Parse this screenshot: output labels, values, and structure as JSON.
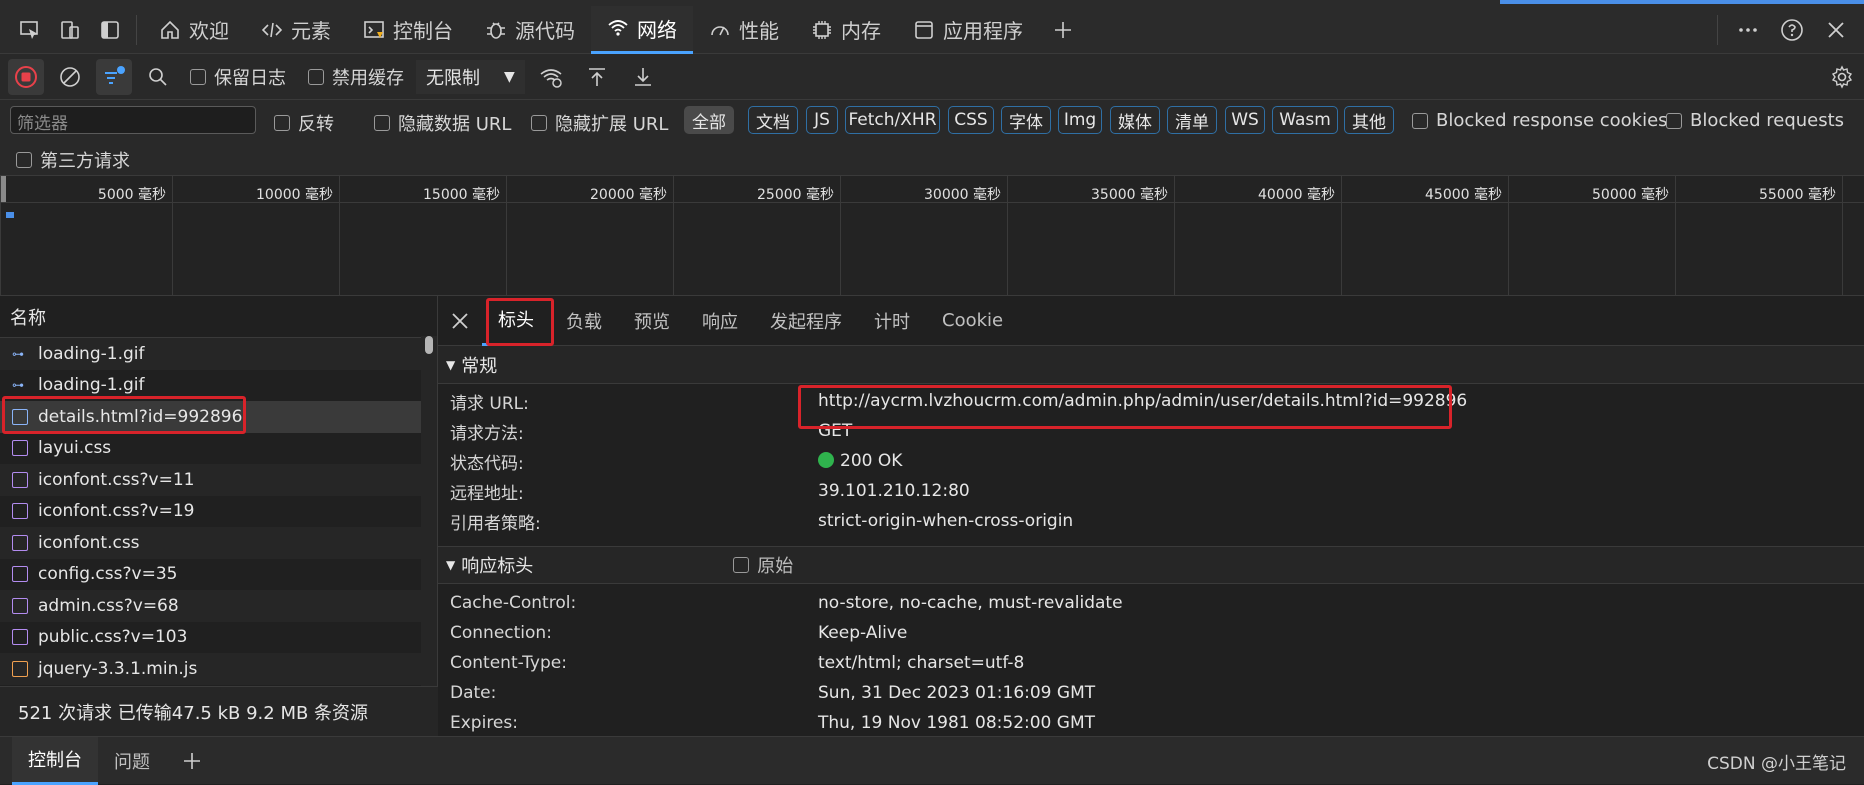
{
  "tabs": [
    {
      "label": "欢迎",
      "icon": "home-icon"
    },
    {
      "label": "元素",
      "icon": "code-icon"
    },
    {
      "label": "控制台",
      "icon": "console-icon"
    },
    {
      "label": "源代码",
      "icon": "bug-icon"
    },
    {
      "label": "网络",
      "icon": "wifi-icon",
      "active": true
    },
    {
      "label": "性能",
      "icon": "gauge-icon"
    },
    {
      "label": "内存",
      "icon": "memory-icon"
    },
    {
      "label": "应用程序",
      "icon": "app-icon"
    }
  ],
  "toolbar": {
    "preserve_log": "保留日志",
    "disable_cache": "禁用缓存",
    "throttle": "无限制"
  },
  "filter": {
    "placeholder": "筛选器",
    "invert": "反转",
    "hide_data_urls": "隐藏数据 URL",
    "hide_ext_urls": "隐藏扩展 URL",
    "types": [
      "全部",
      "文档",
      "JS",
      "Fetch/XHR",
      "CSS",
      "字体",
      "Img",
      "媒体",
      "清单",
      "WS",
      "Wasm",
      "其他"
    ],
    "blocked_cookies": "Blocked response cookies",
    "blocked_requests": "Blocked requests",
    "third_party": "第三方请求"
  },
  "timeline": {
    "ticks": [
      "5000 毫秒",
      "10000 毫秒",
      "15000 毫秒",
      "20000 毫秒",
      "25000 毫秒",
      "30000 毫秒",
      "35000 毫秒",
      "40000 毫秒",
      "45000 毫秒",
      "50000 毫秒",
      "55000 毫秒"
    ]
  },
  "requests": {
    "header": "名称",
    "items": [
      {
        "name": "loading-1.gif",
        "type": "img"
      },
      {
        "name": "loading-1.gif",
        "type": "img"
      },
      {
        "name": "details.html?id=992896",
        "type": "doc",
        "selected": true
      },
      {
        "name": "layui.css",
        "type": "css"
      },
      {
        "name": "iconfont.css?v=11",
        "type": "css"
      },
      {
        "name": "iconfont.css?v=19",
        "type": "css"
      },
      {
        "name": "iconfont.css",
        "type": "css"
      },
      {
        "name": "config.css?v=35",
        "type": "css"
      },
      {
        "name": "admin.css?v=68",
        "type": "css"
      },
      {
        "name": "public.css?v=103",
        "type": "css"
      },
      {
        "name": "jquery-3.3.1.min.js",
        "type": "js"
      }
    ],
    "summary": "521 次请求  已传输47.5 kB  9.2 MB 条资源"
  },
  "detail": {
    "tabs": [
      "标头",
      "负载",
      "预览",
      "响应",
      "发起程序",
      "计时",
      "Cookie"
    ],
    "general": {
      "title": "常规",
      "rows": [
        {
          "k": "请求 URL:",
          "v": "http://aycrm.lvzhoucrm.com/admin.php/admin/user/details.html?id=992896"
        },
        {
          "k": "请求方法:",
          "v": "GET"
        },
        {
          "k": "状态代码:",
          "v": "200 OK"
        },
        {
          "k": "远程地址:",
          "v": "39.101.210.12:80"
        },
        {
          "k": "引用者策略:",
          "v": "strict-origin-when-cross-origin"
        }
      ]
    },
    "response": {
      "title": "响应标头",
      "raw": "原始",
      "rows": [
        {
          "k": "Cache-Control:",
          "v": "no-store, no-cache, must-revalidate"
        },
        {
          "k": "Connection:",
          "v": "Keep-Alive"
        },
        {
          "k": "Content-Type:",
          "v": "text/html; charset=utf-8"
        },
        {
          "k": "Date:",
          "v": "Sun, 31 Dec 2023 01:16:09 GMT"
        },
        {
          "k": "Expires:",
          "v": "Thu, 19 Nov 1981 08:52:00 GMT"
        }
      ]
    }
  },
  "drawer": {
    "tabs": [
      "控制台",
      "问题"
    ]
  },
  "watermark": "CSDN @小王笔记"
}
